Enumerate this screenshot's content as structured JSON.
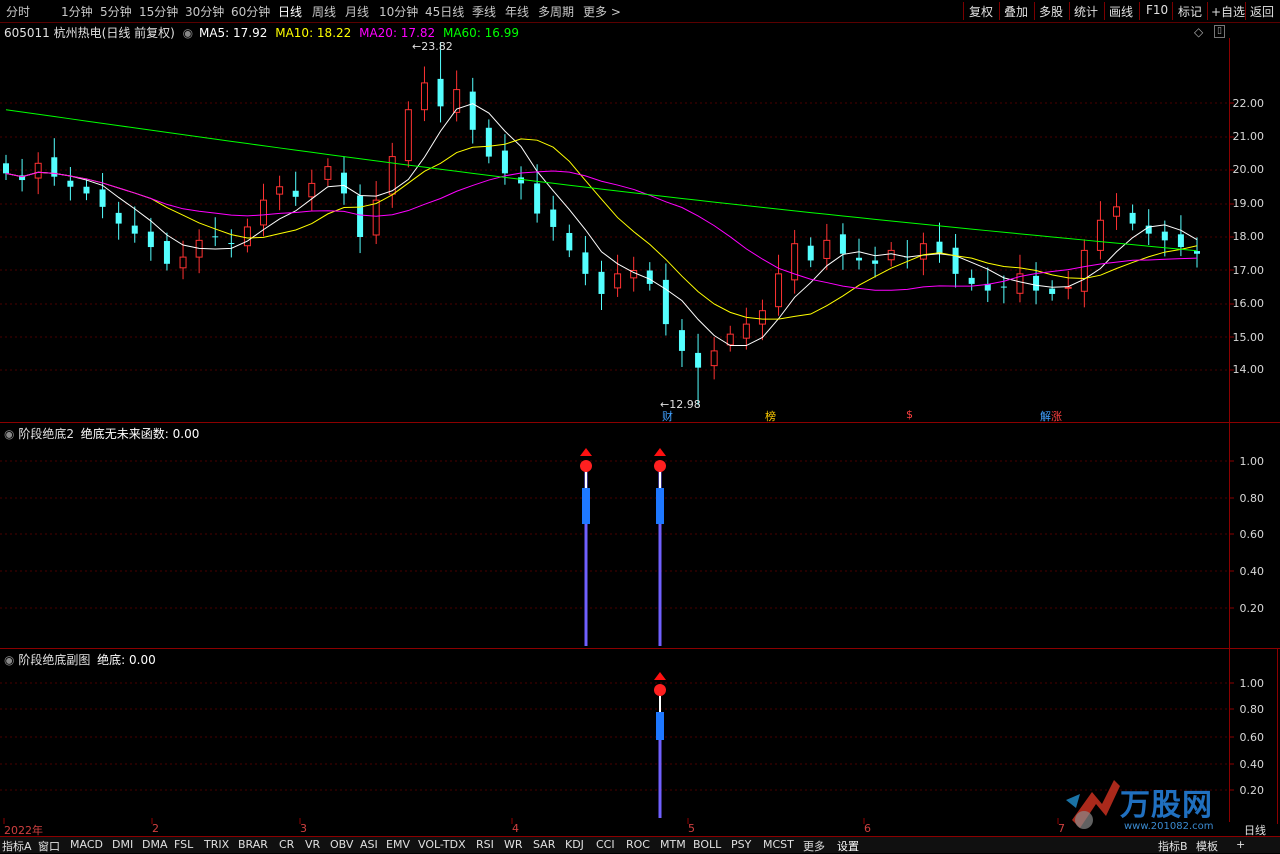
{
  "toolbar": {
    "periods": [
      "分时",
      "1分钟",
      "5分钟",
      "15分钟",
      "30分钟",
      "60分钟",
      "日线",
      "周线",
      "月线",
      "10分钟",
      "45日线",
      "季线",
      "年线",
      "多周期",
      "更多"
    ],
    "active_period": "日线",
    "right_buttons": [
      "复权",
      "叠加",
      "多股",
      "统计",
      "画线",
      "F10",
      "标记",
      "+自选",
      "返回"
    ]
  },
  "main_panel": {
    "stock_code": "605011",
    "stock_name": "杭州热电",
    "mode": "(日线 前复权)",
    "ma_labels": [
      {
        "text": "MA5: 17.92",
        "color": "#ffffff"
      },
      {
        "text": "MA10: 18.22",
        "color": "#ffff00"
      },
      {
        "text": "MA20: 17.82",
        "color": "#ff00ff"
      },
      {
        "text": "MA60: 16.99",
        "color": "#00ff00"
      }
    ],
    "y_ticks": [
      "22.00",
      "21.00",
      "20.00",
      "19.00",
      "18.00",
      "17.00",
      "16.00",
      "15.00",
      "14.00"
    ],
    "high_label": "23.82",
    "low_label": "12.98",
    "markers": [
      {
        "text": "财",
        "color": "#40a0ff"
      },
      {
        "text": "榜",
        "color": "#ffcc00"
      },
      {
        "text": "$",
        "color": "#ff4040"
      },
      {
        "text": "解",
        "color": "#40a0ff"
      },
      {
        "text": "涨",
        "color": "#ff4040"
      }
    ]
  },
  "sub_panel_1": {
    "title": "阶段绝底2",
    "label": "绝底无未来函数: 0.00",
    "y_ticks": [
      "1.00",
      "0.80",
      "0.60",
      "0.40",
      "0.20"
    ],
    "signals": [
      1,
      1
    ]
  },
  "sub_panel_2": {
    "title": "阶段绝底副图",
    "label": "绝底: 0.00",
    "y_ticks": [
      "1.00",
      "0.80",
      "0.60",
      "0.40",
      "0.20"
    ],
    "signals": [
      1
    ]
  },
  "x_axis": [
    "2022年",
    "2",
    "3",
    "4",
    "5",
    "6",
    "7"
  ],
  "x_axis_right": "日线",
  "bottom_tabs": [
    "指标A",
    "窗口",
    "MACD",
    "DMI",
    "DMA",
    "FSL",
    "TRIX",
    "BRAR",
    "CR",
    "VR",
    "OBV",
    "ASI",
    "EMV",
    "VOL-TDX",
    "RSI",
    "WR",
    "SAR",
    "KDJ",
    "CCI",
    "ROC",
    "MTM",
    "BOLL",
    "PSY",
    "MCST",
    "更多",
    "设置"
  ],
  "bottom_right_tabs": [
    "指标B",
    "模板",
    "+"
  ],
  "watermark": {
    "text": "万股网",
    "url": "www.201082.com"
  },
  "colors": {
    "up": "#ff3232",
    "down": "#54ffff",
    "ma5": "#ffffff",
    "ma10": "#ffff00",
    "ma20": "#ff00ff",
    "ma60": "#00ff00",
    "frame": "#8b0000"
  },
  "chart_data": {
    "type": "candlestick",
    "price_range": [
      12.98,
      23.82
    ],
    "approx_closes": [
      19.9,
      19.7,
      20.2,
      19.8,
      19.5,
      19.3,
      18.9,
      18.4,
      18.1,
      17.7,
      17.2,
      17.4,
      17.9,
      18.0,
      17.8,
      18.3,
      19.1,
      19.5,
      19.2,
      19.6,
      20.1,
      19.3,
      18.0,
      19.1,
      20.4,
      21.8,
      22.6,
      21.9,
      22.4,
      21.2,
      20.4,
      19.9,
      19.6,
      18.7,
      18.3,
      17.6,
      16.9,
      16.3,
      16.9,
      17.0,
      16.6,
      15.4,
      14.6,
      14.1,
      14.6,
      15.1,
      15.4,
      15.8,
      16.9,
      17.8,
      17.3,
      17.9,
      17.5,
      17.3,
      17.2,
      17.6,
      17.4,
      17.8,
      17.5,
      16.9,
      16.6,
      16.4,
      16.5,
      16.9,
      16.4,
      16.3,
      16.5,
      17.6,
      18.5,
      18.9,
      18.4,
      18.1,
      17.9,
      17.7,
      17.5
    ]
  }
}
